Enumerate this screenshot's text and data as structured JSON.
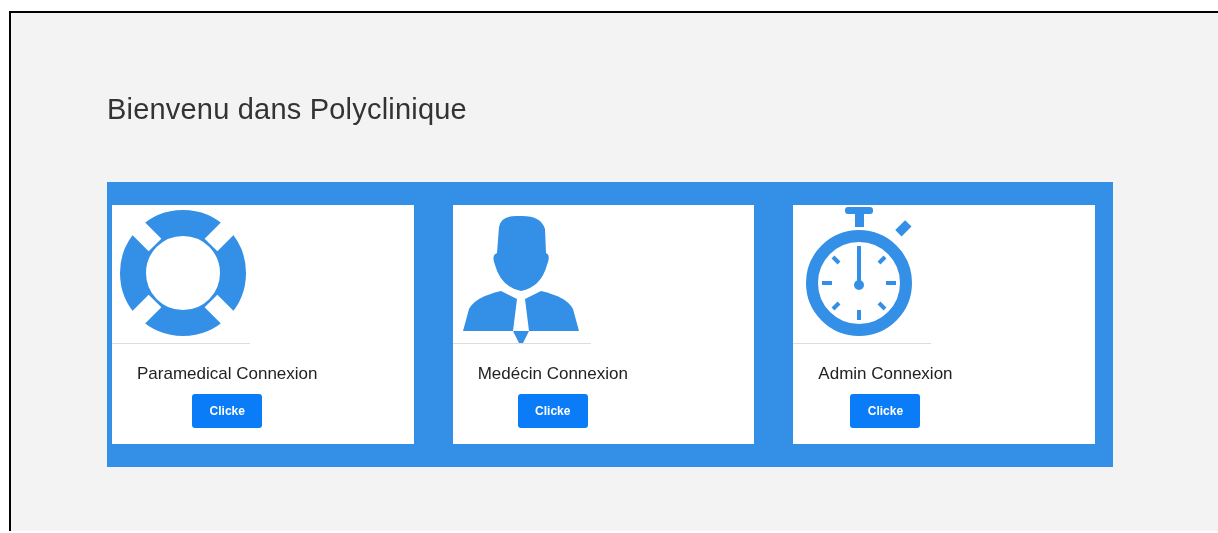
{
  "title": "Bienvenu dans Polyclinique",
  "cards": [
    {
      "kind": "lifebuoy",
      "label": "Paramedical Connexion",
      "button": "Clicke"
    },
    {
      "kind": "doctor",
      "label": "Medécin Connexion",
      "button": "Clicke"
    },
    {
      "kind": "stopwatch",
      "label": "Admin Connexion",
      "button": "Clicke"
    }
  ]
}
